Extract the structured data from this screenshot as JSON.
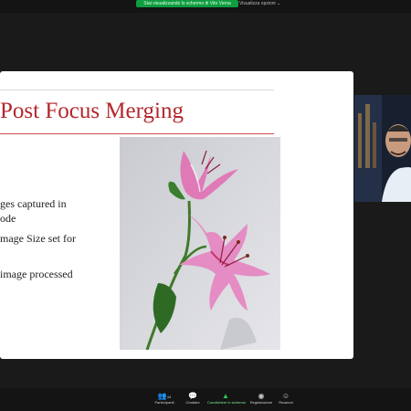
{
  "window": {
    "share_banner": "Stai visualizzando lo schermo di Vito Verna",
    "view_options": "Visualizza opzioni"
  },
  "slide": {
    "title": "Post Focus Merging",
    "bullets": [
      "ges captured in",
      "ode",
      "mage Size set for",
      "image processed"
    ]
  },
  "toolbar": {
    "participants_count": "44",
    "items": [
      {
        "label": "Partecipanti",
        "icon": "participants-icon"
      },
      {
        "label": "Chattare",
        "icon": "chat-icon"
      },
      {
        "label": "Condividere lo schermo",
        "icon": "share-screen-icon"
      },
      {
        "label": "Registrazione",
        "icon": "record-icon"
      },
      {
        "label": "Reazioni",
        "icon": "reactions-icon"
      }
    ]
  },
  "colors": {
    "accent_green": "#0e9d3f",
    "title_red": "#b3272d",
    "background": "#1a1a1a"
  }
}
